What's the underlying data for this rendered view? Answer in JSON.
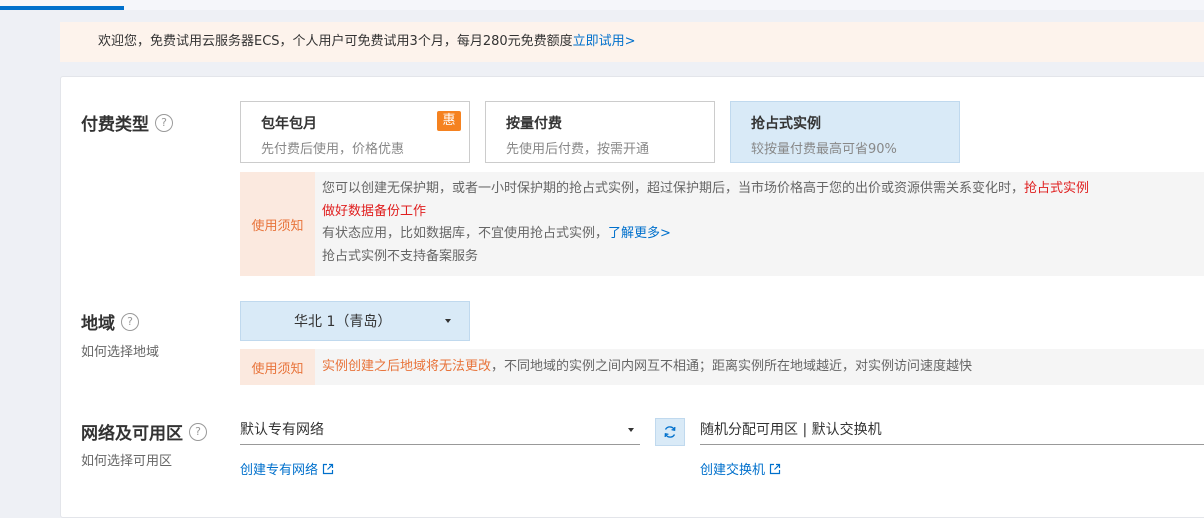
{
  "promo": {
    "text": "欢迎您，免费试用云服务器ECS，个人用户可免费试用3个月，每月280元免费额度",
    "link": "立即试用>"
  },
  "billing": {
    "title": "付费类型",
    "help": "?",
    "options": [
      {
        "title": "包年包月",
        "desc": "先付费后使用，价格优惠",
        "badge": "惠"
      },
      {
        "title": "按量付费",
        "desc": "先使用后付费，按需开通"
      },
      {
        "title": "抢占式实例",
        "desc": "较按量付费最高可省90%"
      }
    ],
    "notice": {
      "label": "使用须知",
      "line1": "您可以创建无保护期，或者一小时保护期的抢占式实例，超过保护期后，当市场价格高于您的出价或资源供需关系变化时，",
      "line1_red": "抢占式实例",
      "line2_red": "做好数据备份工作",
      "line3": "有状态应用，比如数据库，不宜使用抢占式实例，",
      "line3_link": "了解更多>",
      "line4": "抢占式实例不支持备案服务"
    }
  },
  "region": {
    "title": "地域",
    "help": "?",
    "subtitle": "如何选择地域",
    "selected": "华北 1（青岛）",
    "notice": {
      "label": "使用须知",
      "red": "实例创建之后地域将无法更改",
      "text": "，不同地域的实例之间内网互不相通；距离实例所在地域越近，对实例访问速度越快"
    }
  },
  "network": {
    "title": "网络及可用区",
    "help": "?",
    "subtitle": "如何选择可用区",
    "vpc_value": "默认专有网络",
    "zone_value": "随机分配可用区 | 默认交换机",
    "create_vpc_link": "创建专有网络",
    "create_switch_link": "创建交换机"
  },
  "colors": {
    "accent": "#0070cc",
    "selected_bg": "#d9eaf7",
    "badge": "#f58220",
    "notice_label": "#e8743b",
    "warning_red": "#e02020"
  }
}
